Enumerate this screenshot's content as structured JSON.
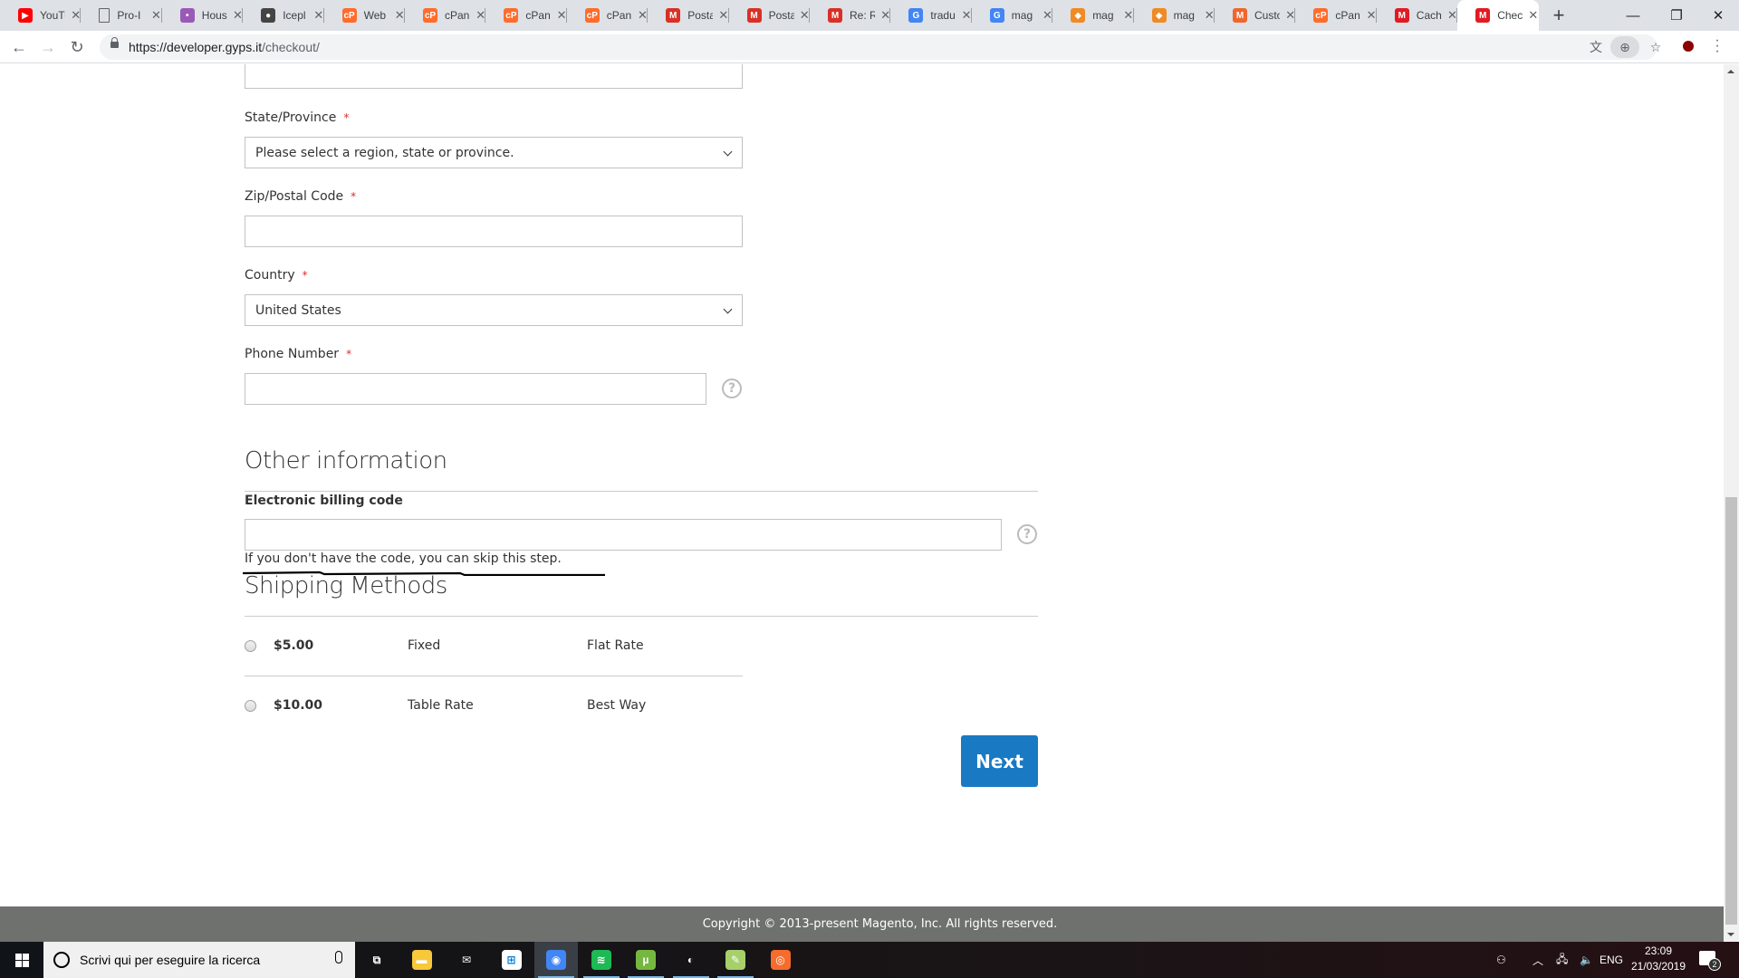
{
  "browser": {
    "tabs": [
      {
        "title": "YouTube",
        "icon": "youtube-icon",
        "color": "#ff0000",
        "glyph": "▶",
        "muted": false,
        "audio": true
      },
      {
        "title": "Pro-I",
        "icon": "document-icon",
        "color": "#ffffff",
        "glyph": ""
      },
      {
        "title": "Hous",
        "icon": "house-icon",
        "color": "#9b59b6",
        "glyph": "•"
      },
      {
        "title": "Icepl",
        "icon": "iceplay-icon",
        "color": "#444444",
        "glyph": "●"
      },
      {
        "title": "Web",
        "icon": "cpanel-icon",
        "color": "#ff6c2c",
        "glyph": "cP"
      },
      {
        "title": "cPan",
        "icon": "cpanel-icon",
        "color": "#ff6c2c",
        "glyph": "cP"
      },
      {
        "title": "cPan",
        "icon": "cpanel-icon",
        "color": "#ff6c2c",
        "glyph": "cP"
      },
      {
        "title": "cPan",
        "icon": "cpanel-icon",
        "color": "#ff6c2c",
        "glyph": "cP"
      },
      {
        "title": "Posta",
        "icon": "gmail-icon",
        "color": "#d93025",
        "glyph": "M"
      },
      {
        "title": "Posta",
        "icon": "gmail-icon",
        "color": "#d93025",
        "glyph": "M"
      },
      {
        "title": "Re: R",
        "icon": "gmail-icon",
        "color": "#d93025",
        "glyph": "M"
      },
      {
        "title": "tradu",
        "icon": "google-icon",
        "color": "#4285f4",
        "glyph": "G"
      },
      {
        "title": "mag",
        "icon": "google-icon",
        "color": "#4285f4",
        "glyph": "G"
      },
      {
        "title": "mag",
        "icon": "magento-forum-icon",
        "color": "#f08a24",
        "glyph": "◆"
      },
      {
        "title": "mag",
        "icon": "magento-forum-icon",
        "color": "#f08a24",
        "glyph": "◆"
      },
      {
        "title": "Custo",
        "icon": "magento-icon",
        "color": "#ee672f",
        "glyph": "M"
      },
      {
        "title": "cPan",
        "icon": "cpanel-icon",
        "color": "#ff6c2c",
        "glyph": "cP"
      },
      {
        "title": "Cach",
        "icon": "magento-icon",
        "color": "#e11b22",
        "glyph": "M"
      },
      {
        "title": "Chec",
        "icon": "magento-icon",
        "color": "#e11b22",
        "glyph": "M",
        "active": true
      }
    ],
    "url_host": "https://developer.gyps.it",
    "url_path": "/checkout/",
    "window_controls": {
      "minimize": "—",
      "restore": "❐",
      "close": "✕"
    }
  },
  "form": {
    "street_value": "",
    "state": {
      "label": "State/Province",
      "required": "*",
      "value": "Please select a region, state or province."
    },
    "zip": {
      "label": "Zip/Postal Code",
      "required": "*",
      "value": ""
    },
    "country": {
      "label": "Country",
      "required": "*",
      "value": "United States"
    },
    "phone": {
      "label": "Phone Number",
      "required": "*",
      "value": "",
      "help": "?"
    }
  },
  "other_info": {
    "title": "Other information",
    "billing_label": "Electronic billing code",
    "billing_value": "",
    "help": "?",
    "note": "If you don't have the code, you can skip this step."
  },
  "shipping": {
    "title": "Shipping Methods",
    "methods": [
      {
        "price": "$5.00",
        "method": "Fixed",
        "carrier": "Flat Rate",
        "selected": false
      },
      {
        "price": "$10.00",
        "method": "Table Rate",
        "carrier": "Best Way",
        "selected": false
      }
    ],
    "next_label": "Next"
  },
  "footer": {
    "copyright": "Copyright © 2013-present Magento, Inc. All rights reserved."
  },
  "taskbar": {
    "search_placeholder": "Scrivi qui per eseguire la ricerca",
    "apps": [
      {
        "name": "task-view",
        "color": "transparent",
        "glyph": "⧉"
      },
      {
        "name": "file-explorer",
        "color": "#f8c83a",
        "glyph": "▬"
      },
      {
        "name": "mail",
        "color": "transparent",
        "glyph": "✉"
      },
      {
        "name": "store",
        "color": "#ffffff",
        "glyph": "⊞"
      },
      {
        "name": "chrome",
        "color": "#4285f4",
        "glyph": "◉",
        "active": true
      },
      {
        "name": "spotify",
        "color": "#1db954",
        "glyph": "≋",
        "running": true
      },
      {
        "name": "utorrent",
        "color": "#76b83f",
        "glyph": "µ",
        "running": true
      },
      {
        "name": "audio-app",
        "color": "transparent",
        "glyph": "◐",
        "running": true
      },
      {
        "name": "notepad-plus",
        "color": "#a6d06a",
        "glyph": "✎",
        "running": true
      },
      {
        "name": "origin",
        "color": "#f56c2d",
        "glyph": "◎"
      }
    ],
    "language": "ENG",
    "time": "23:09",
    "date": "21/03/2019",
    "notifications": "2"
  }
}
